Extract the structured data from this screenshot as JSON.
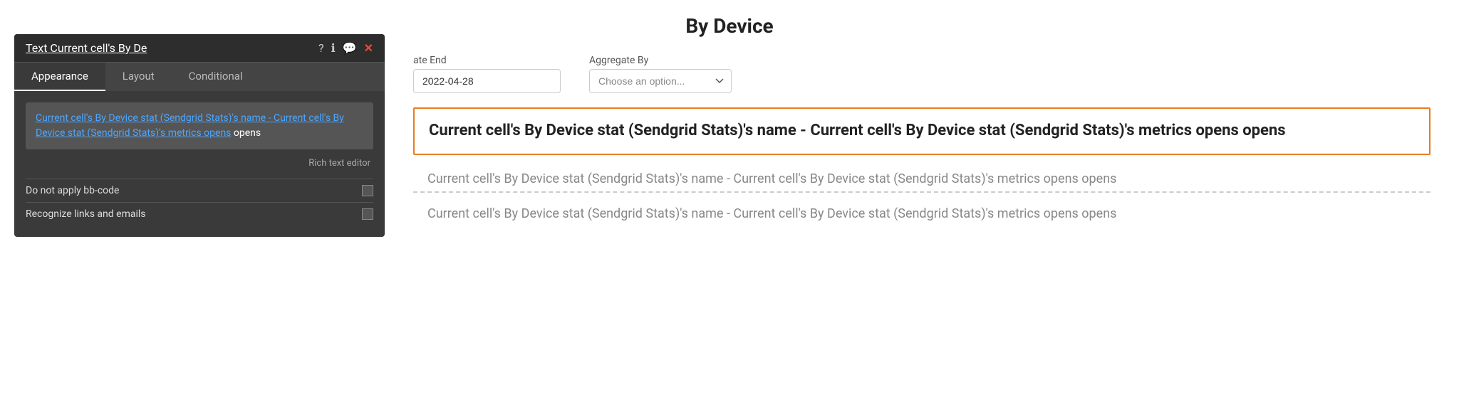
{
  "page": {
    "title": "By Device"
  },
  "top_bar": {
    "date_end_label": "ate End",
    "date_end_value": "2022-04-28",
    "aggregate_by_label": "Aggregate By",
    "aggregate_by_placeholder": "Choose an option..."
  },
  "cells": {
    "selected": {
      "text": "Current cell's By Device stat (Sendgrid Stats)'s name - Current cell's By Device stat (Sendgrid Stats)'s metrics opens opens"
    },
    "normal": {
      "text": "Current cell's By Device stat (Sendgrid Stats)'s name - Current cell's By Device stat (Sendgrid Stats)'s metrics opens opens"
    },
    "dashed": {
      "text": "Current cell's By Device stat (Sendgrid Stats)'s name - Current cell's By Device stat (Sendgrid Stats)'s metrics opens opens"
    }
  },
  "panel": {
    "title": "Text Current cell's By De",
    "icons": {
      "question": "?",
      "info": "ℹ",
      "comment": "💬",
      "close": "✕"
    },
    "tabs": [
      {
        "label": "Appearance",
        "active": true
      },
      {
        "label": "Layout",
        "active": false
      },
      {
        "label": "Conditional",
        "active": false
      }
    ],
    "preview": {
      "link_text": "Current cell's By Device stat (Sendgrid Stats)'s name - Current cell's By Device stat (Sendgrid Stats)'s metrics opens",
      "plain_text": " opens"
    },
    "rich_text_label": "Rich text editor",
    "options": [
      {
        "label": "Do not apply bb-code"
      },
      {
        "label": "Recognize links and emails"
      }
    ]
  }
}
